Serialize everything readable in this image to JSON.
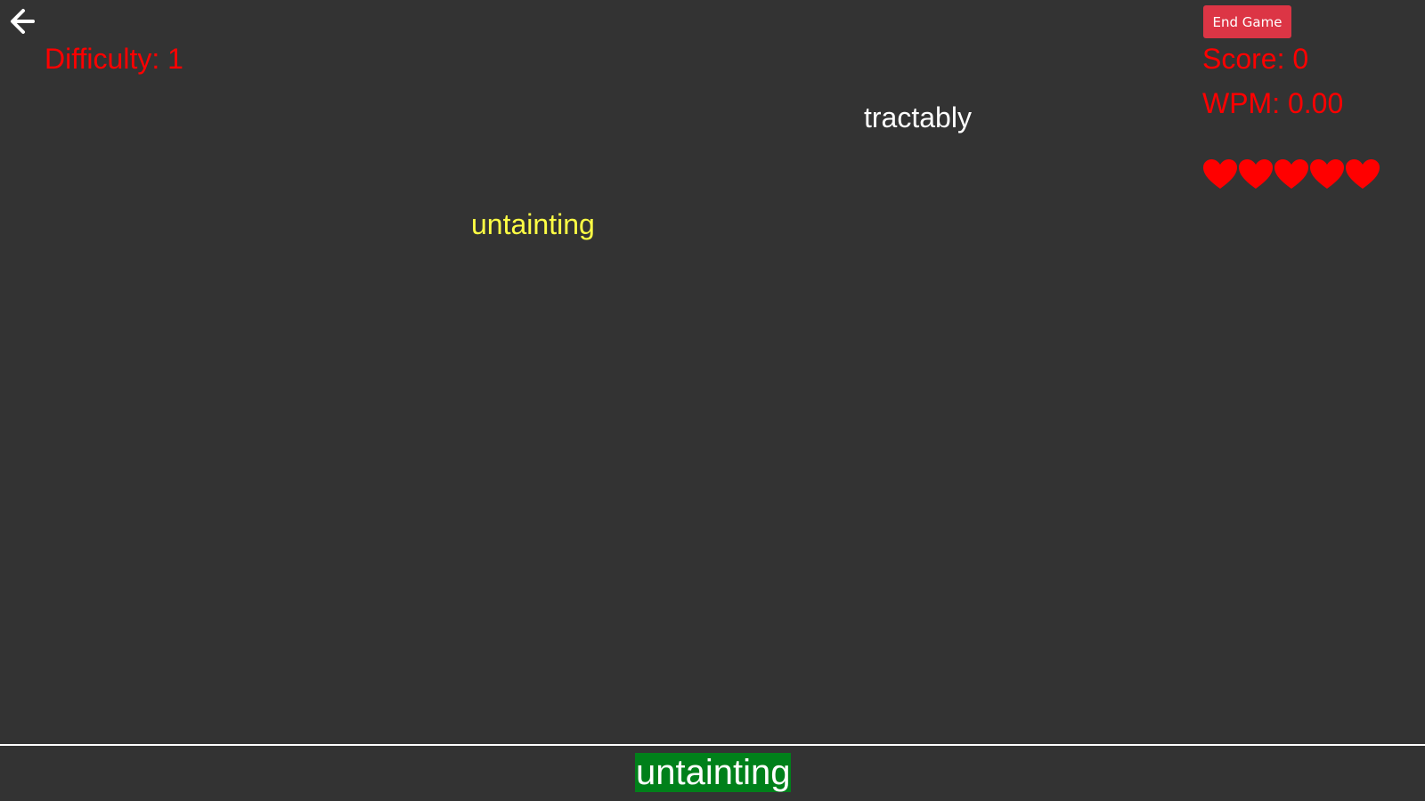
{
  "header": {
    "back_icon": "arrow-left-icon",
    "difficulty_text": "Difficulty: 1",
    "end_game_label": "End Game",
    "score_text": "Score: 0",
    "wpm_text": "WPM: 0.00"
  },
  "lives": {
    "icon": "heart-icon",
    "remaining": 5,
    "color": "#ff0000"
  },
  "falling_words": [
    {
      "text": "tractably",
      "state": "idle",
      "color": "#ffffff"
    },
    {
      "text": "untainting",
      "state": "targeted",
      "color": "#ffff44"
    }
  ],
  "input": {
    "typed_text": "untainting",
    "highlight_color": "#00801a"
  },
  "colors": {
    "background": "#333333",
    "stat_text": "#ff0000",
    "end_button": "#dc3545"
  }
}
